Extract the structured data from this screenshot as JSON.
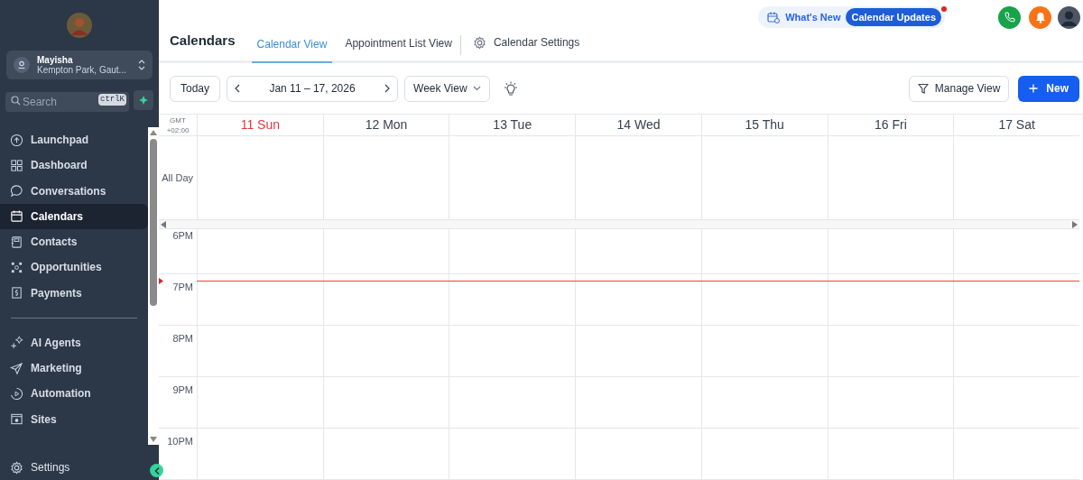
{
  "sidebar": {
    "account": {
      "name": "Mayisha",
      "location": "Kempton Park, Gaut..."
    },
    "search": {
      "placeholder": "Search",
      "shortcut": "ctrlK"
    },
    "nav_groups": [
      {
        "items": [
          {
            "label": "Launchpad",
            "selected": false
          },
          {
            "label": "Dashboard",
            "selected": false
          },
          {
            "label": "Conversations",
            "selected": false
          },
          {
            "label": "Calendars",
            "selected": true
          },
          {
            "label": "Contacts",
            "selected": false
          },
          {
            "label": "Opportunities",
            "selected": false
          },
          {
            "label": "Payments",
            "selected": false
          }
        ]
      },
      {
        "items": [
          {
            "label": "AI Agents",
            "selected": false
          },
          {
            "label": "Marketing",
            "selected": false
          },
          {
            "label": "Automation",
            "selected": false
          },
          {
            "label": "Sites",
            "selected": false
          }
        ]
      }
    ],
    "footer": {
      "label": "Settings"
    }
  },
  "topbar": {
    "whats_new": "What's New",
    "badge": "Calendar Updates",
    "badge_unread": true
  },
  "page": {
    "title": "Calendars",
    "tabs": [
      {
        "label": "Calendar View",
        "selected": true
      },
      {
        "label": "Appointment List View",
        "selected": false
      }
    ],
    "settings": "Calendar Settings"
  },
  "toolbar": {
    "today": "Today",
    "range": "Jan 11 – 17, 2026",
    "view": "Week View",
    "manage": "Manage View",
    "new": "New"
  },
  "calendar": {
    "timezone": [
      "GMT",
      "+02:00"
    ],
    "all_day": "All Day",
    "days": [
      {
        "label": "11 Sun",
        "today": true
      },
      {
        "label": "12 Mon",
        "today": false
      },
      {
        "label": "13 Tue",
        "today": false
      },
      {
        "label": "14 Wed",
        "today": false
      },
      {
        "label": "15 Thu",
        "today": false
      },
      {
        "label": "16 Fri",
        "today": false
      },
      {
        "label": "17 Sat",
        "today": false
      }
    ],
    "hours": [
      {
        "label": "6PM",
        "now": false
      },
      {
        "label": "7PM",
        "now": true
      },
      {
        "label": "8PM",
        "now": false
      },
      {
        "label": "9PM",
        "now": false
      },
      {
        "label": "10PM",
        "now": false
      }
    ]
  }
}
